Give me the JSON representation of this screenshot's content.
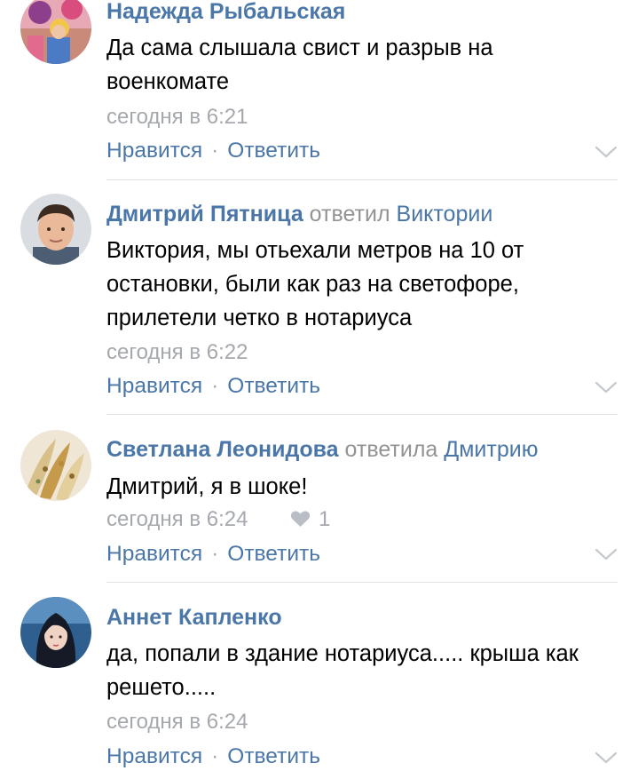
{
  "comments": [
    {
      "author": "Надежда Рыбальская",
      "reply_word": "",
      "reply_target": "",
      "text": "Да сама слышала свист и разрыв на военкомате",
      "time": "сегодня в 6:21",
      "likes": "",
      "like_label": "Нравится",
      "separator": "·",
      "reply_label": "Ответить"
    },
    {
      "author": "Дмитрий Пятница",
      "reply_word": "ответил",
      "reply_target": "Виктории",
      "text": "Виктория, мы отьехали метров на 10 от остановки, были как раз на светофоре, прилетели четко в нотариуса",
      "time": "сегодня в 6:22",
      "likes": "",
      "like_label": "Нравится",
      "separator": "·",
      "reply_label": "Ответить"
    },
    {
      "author": "Светлана Леонидова",
      "reply_word": "ответила",
      "reply_target": "Дмитрию",
      "text": "Дмитрий, я в шоке!",
      "time": "сегодня в 6:24",
      "likes": "1",
      "like_label": "Нравится",
      "separator": "·",
      "reply_label": "Ответить"
    },
    {
      "author": "Аннет Капленко",
      "reply_word": "",
      "reply_target": "",
      "text": "да, попали в здание нотариуса..... крыша как решето.....",
      "time": "сегодня в 6:24",
      "likes": "",
      "like_label": "Нравится",
      "separator": "·",
      "reply_label": "Ответить"
    }
  ],
  "colors": {
    "link": "#4a76a8",
    "muted": "#a5a9ae",
    "reply_word": "#939393",
    "text": "#000000",
    "divider": "#dfe2e6"
  },
  "icons": {
    "like": "heart-icon",
    "more": "chevron-down-icon"
  }
}
